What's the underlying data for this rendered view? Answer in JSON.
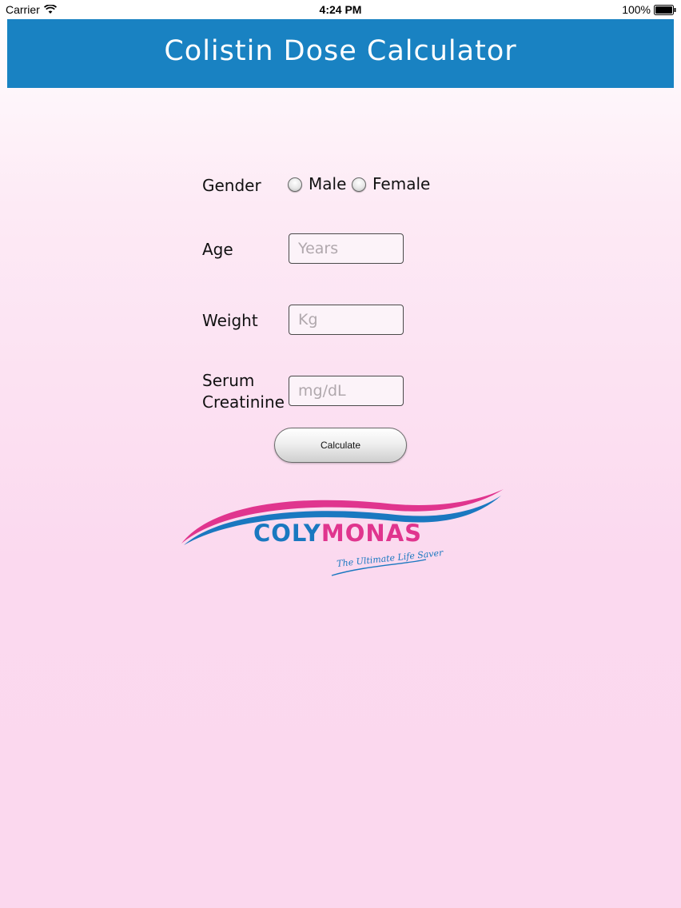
{
  "status_bar": {
    "carrier": "Carrier",
    "time": "4:24 PM",
    "battery": "100%"
  },
  "header": {
    "title": "Colistin Dose Calculator"
  },
  "form": {
    "gender": {
      "label": "Gender",
      "options": [
        "Male",
        "Female"
      ],
      "selected": null
    },
    "age": {
      "label": "Age",
      "value": "",
      "placeholder": "Years"
    },
    "weight": {
      "label": "Weight",
      "value": "",
      "placeholder": "Kg"
    },
    "creatinine": {
      "label_line1": "Serum",
      "label_line2": "Creatinine",
      "value": "",
      "placeholder": "mg/dL"
    },
    "calculate_label": "Calculate"
  },
  "logo": {
    "part1": "COLY",
    "part2": "MONAS",
    "tagline": "The Ultimate Life Saver",
    "colors": {
      "blue": "#1a78c0",
      "pink": "#e0358e"
    }
  },
  "colors": {
    "header_bg": "#1982c2",
    "header_text": "#ffffff"
  },
  "icons": {
    "wifi": "wifi-icon",
    "battery": "battery-icon"
  }
}
